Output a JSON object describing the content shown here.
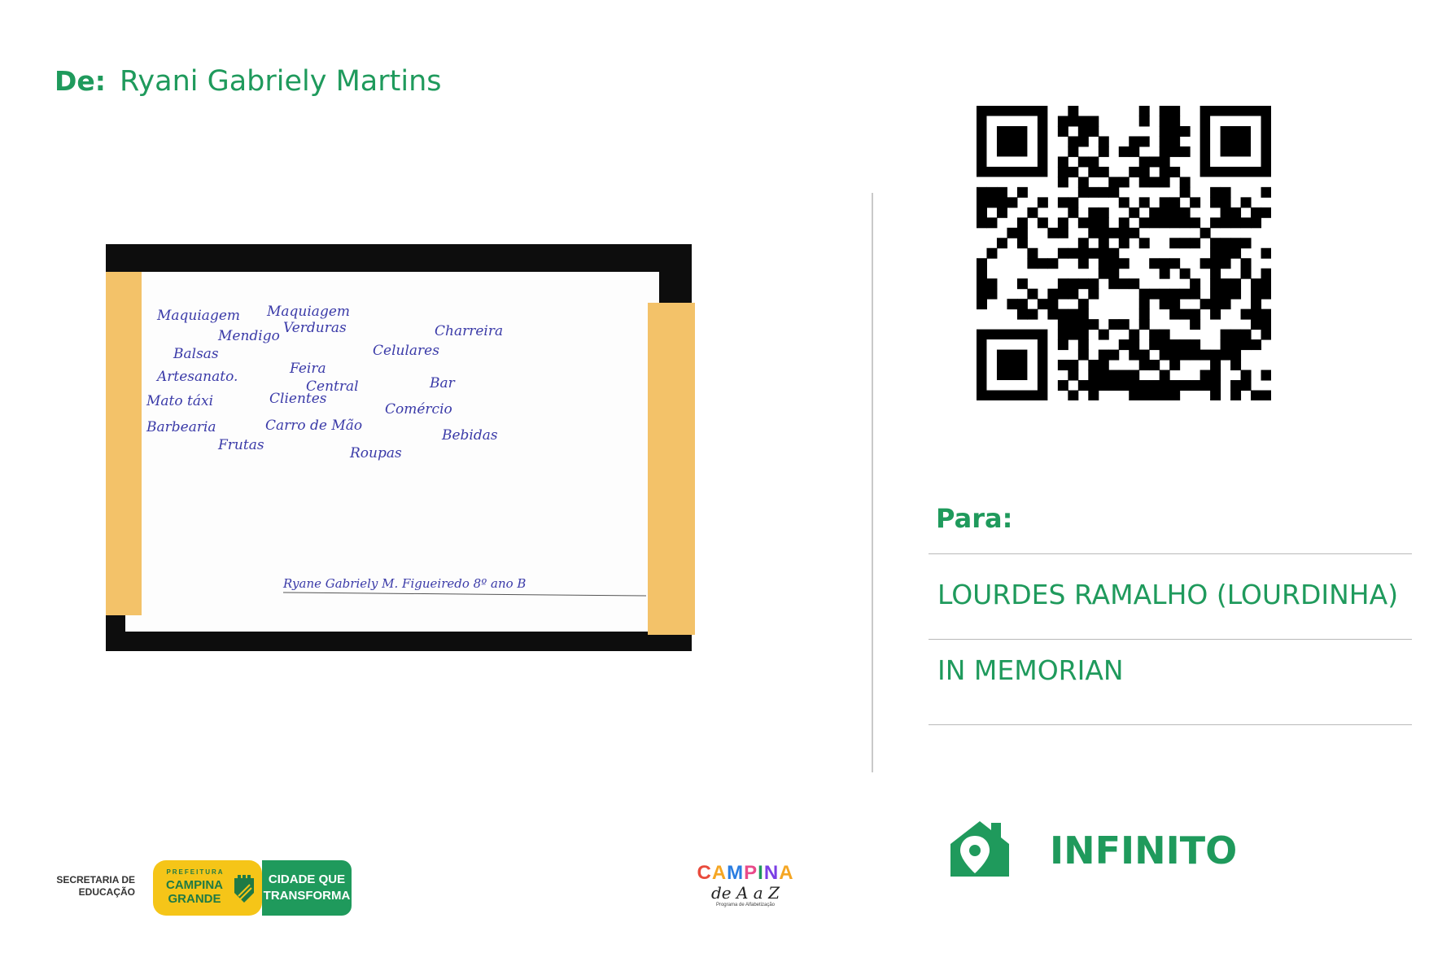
{
  "sender": {
    "label": "De:",
    "name": "Ryani Gabriely Martins"
  },
  "photo": {
    "words": [
      "Maquiagem",
      "Maquiagem",
      "Charreira",
      "Mendigo",
      "Verduras",
      "Celulares",
      "Balsas",
      "Feira",
      "Central",
      "Bar",
      "Artesanato.",
      "Mato táxi",
      "Clientes",
      "Comércio",
      "Barbearia",
      "Carro de Mão",
      "Bebidas",
      "Frutas",
      "Roupas"
    ],
    "signature": "Ryane Gabriely M. Figueiredo 8º ano B"
  },
  "qr": {
    "icon": "qr-code"
  },
  "recipient": {
    "label": "Para:",
    "line1": "LOURDES RAMALHO (LOURDINHA)",
    "line2": "IN MEMORIAN"
  },
  "place": {
    "icon": "home-location-icon",
    "name": "INFINITO"
  },
  "logos": {
    "secretaria": "SECRETARIA DE EDUCAÇÃO",
    "prefeitura_small": "PREFEITURA",
    "prefeitura_city": "CAMPINA GRANDE",
    "slogan": "CIDADE QUE TRANSFORMA",
    "campina_word": "CAMPINA",
    "campina_sub": "de A a Z",
    "campina_note": "Programa de Alfabetização"
  },
  "colors": {
    "accent": "#1f9a5c",
    "yellow": "#f5c518",
    "tape": "#f3c269",
    "ink": "#3a3aa8"
  }
}
